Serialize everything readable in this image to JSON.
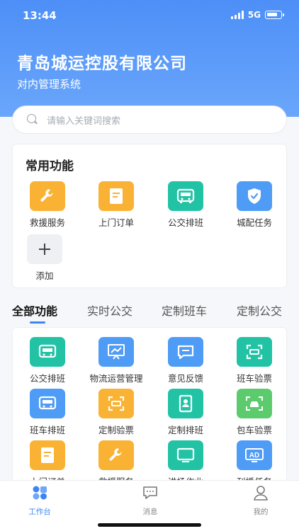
{
  "status": {
    "time": "13:44",
    "network": "5G"
  },
  "header": {
    "title": "青岛城运控股有限公司",
    "subtitle": "对内管理系统"
  },
  "search": {
    "placeholder": "请输入关键词搜索"
  },
  "common": {
    "title": "常用功能",
    "items": [
      {
        "label": "救援服务",
        "icon": "wrench-icon",
        "color": "#f9b233"
      },
      {
        "label": "上门订单",
        "icon": "document-icon",
        "color": "#f9b233"
      },
      {
        "label": "公交排班",
        "icon": "bus-icon",
        "color": "#22c3a5"
      },
      {
        "label": "城配任务",
        "icon": "shield-check-icon",
        "color": "#4e9cf5"
      },
      {
        "label": "添加",
        "icon": "plus-icon",
        "color": "#eef0f3"
      }
    ]
  },
  "tabs": [
    "全部功能",
    "实时公交",
    "定制班车",
    "定制公交"
  ],
  "all": {
    "items": [
      {
        "label": "公交排班",
        "icon": "bus-icon",
        "color": "#22c3a5"
      },
      {
        "label": "物流运营管理",
        "icon": "chart-board-icon",
        "color": "#4e9cf5"
      },
      {
        "label": "意见反馈",
        "icon": "message-icon",
        "color": "#4e9cf5"
      },
      {
        "label": "班车验票",
        "icon": "scan-icon",
        "color": "#22c3a5"
      },
      {
        "label": "班车排班",
        "icon": "bus-icon",
        "color": "#4e9cf5"
      },
      {
        "label": "定制验票",
        "icon": "scan-icon",
        "color": "#f9b233"
      },
      {
        "label": "定制排班",
        "icon": "contacts-book-icon",
        "color": "#22c3a5"
      },
      {
        "label": "包车验票",
        "icon": "car-icon",
        "color": "#5ccb6d"
      },
      {
        "label": "上门订单",
        "icon": "document-icon",
        "color": "#f9b233"
      },
      {
        "label": "救援服务",
        "icon": "wrench-icon",
        "color": "#f9b233"
      },
      {
        "label": "进场作业",
        "icon": "monitor-icon",
        "color": "#22c3a5"
      },
      {
        "label": "刊播任务",
        "icon": "ad-icon",
        "color": "#4e9cf5"
      }
    ]
  },
  "nav": [
    {
      "label": "工作台",
      "icon": "workbench-icon"
    },
    {
      "label": "消息",
      "icon": "chat-icon"
    },
    {
      "label": "我的",
      "icon": "user-icon"
    }
  ]
}
